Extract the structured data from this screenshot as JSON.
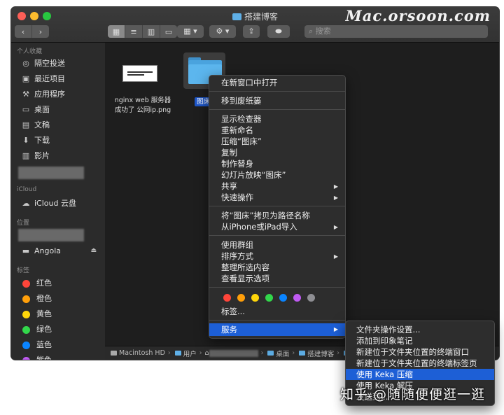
{
  "window": {
    "title": "搭建博客",
    "watermark": "Mac.orsoon.com"
  },
  "toolbar": {
    "search_placeholder": "搜索"
  },
  "sidebar": {
    "favorites_header": "个人收藏",
    "favorites": [
      {
        "icon": "airdrop-icon",
        "label": "隔空投送"
      },
      {
        "icon": "recents-icon",
        "label": "最近项目"
      },
      {
        "icon": "applications-icon",
        "label": "应用程序"
      },
      {
        "icon": "desktop-icon",
        "label": "桌面"
      },
      {
        "icon": "documents-icon",
        "label": "文稿"
      },
      {
        "icon": "downloads-icon",
        "label": "下载"
      },
      {
        "icon": "movies-icon",
        "label": "影片"
      }
    ],
    "icloud_header": "iCloud",
    "icloud_drive": "iCloud 云盘",
    "locations_header": "位置",
    "disk": "Angola",
    "tags_header": "标签",
    "tags": [
      {
        "label": "红色",
        "color": "#ff453a"
      },
      {
        "label": "橙色",
        "color": "#ff9f0a"
      },
      {
        "label": "黄色",
        "color": "#ffd60a"
      },
      {
        "label": "绿色",
        "color": "#32d74b"
      },
      {
        "label": "蓝色",
        "color": "#0a84ff"
      },
      {
        "label": "紫色",
        "color": "#bf5af2"
      }
    ]
  },
  "files": {
    "image_file_line1": "nginx web 服务器",
    "image_file_line2": "成功了 公网ip.png",
    "folder_label": "图床"
  },
  "pathbar": {
    "disk": "Macintosh HD",
    "users": "用户",
    "desktop": "桌面",
    "folder": "搭建博客",
    "last": "图"
  },
  "context_menu": {
    "open_new_window": "在新窗口中打开",
    "move_to_trash": "移到废纸篓",
    "get_info": "显示检查器",
    "rename": "重新命名",
    "compress": "压缩“图床”",
    "duplicate": "复制",
    "make_alias": "制作替身",
    "slideshow": "幻灯片放映“图床”",
    "share": "共享",
    "quick_actions": "快速操作",
    "copy_as_path": "将“图床”拷贝为路径名称",
    "import_from_iphone": "从iPhone或iPad导入",
    "use_groups": "使用群组",
    "sort_by": "排序方式",
    "clean_up": "整理所选内容",
    "view_options": "查看显示选项",
    "tags": "标签...",
    "services": "服务",
    "tag_colors": [
      "#ff453a",
      "#ff9f0a",
      "#ffd60a",
      "#32d74b",
      "#0a84ff",
      "#bf5af2",
      "#8e8e93"
    ]
  },
  "services_menu": {
    "folder_actions": "文件夹操作设置...",
    "add_to_evernote": "添加到印象笔记",
    "new_terminal_window": "新建位于文件夹位置的终端窗口",
    "new_terminal_tab": "新建位于文件夹位置的终端标签页",
    "keka_compress": "使用 Keka 压缩",
    "keka_extract": "使用 Keka 解压",
    "send_to": "发送到..."
  },
  "credit": "知乎 @随随便便逛一逛"
}
